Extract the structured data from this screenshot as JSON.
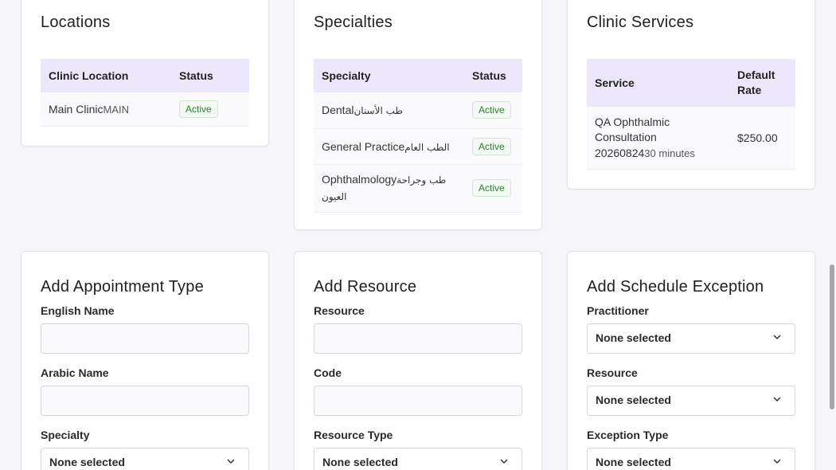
{
  "locations": {
    "title": "Locations",
    "headers": [
      "Clinic Location",
      "Status"
    ],
    "rows": [
      {
        "name": "Main Clinic",
        "code": "MAIN",
        "status": "Active"
      }
    ]
  },
  "specialties": {
    "title": "Specialties",
    "headers": [
      "Specialty",
      "Status"
    ],
    "rows": [
      {
        "name": "Dental",
        "arabic": "طب الأسنان",
        "status": "Active"
      },
      {
        "name": "General Practice",
        "arabic": "الطب العام",
        "status": "Active"
      },
      {
        "name": "Ophthalmology",
        "arabic": "طب وجراحة العيون",
        "status": "Active"
      }
    ]
  },
  "services": {
    "title": "Clinic Services",
    "headers": [
      "Service",
      "Default Rate"
    ],
    "rows": [
      {
        "name_line1": "QA Ophthalmic",
        "name_line2": "Consultation",
        "name_line3": "20260824",
        "duration": "30 minutes",
        "rate": "$250.00"
      }
    ]
  },
  "add_appointment_type": {
    "title": "Add Appointment Type",
    "english_name_label": "English Name",
    "english_name_value": "",
    "arabic_name_label": "Arabic Name",
    "arabic_name_value": "",
    "specialty_label": "Specialty",
    "specialty_value": "None selected"
  },
  "add_resource": {
    "title": "Add Resource",
    "resource_label": "Resource",
    "resource_value": "",
    "code_label": "Code",
    "code_value": "",
    "resource_type_label": "Resource Type",
    "resource_type_value": "None selected"
  },
  "add_schedule_exception": {
    "title": "Add Schedule Exception",
    "practitioner_label": "Practitioner",
    "practitioner_value": "None selected",
    "resource_label": "Resource",
    "resource_value": "None selected",
    "exception_type_label": "Exception Type",
    "exception_type_value": "None selected"
  },
  "colors": {
    "table_header_bg": "#ece7fb",
    "status_active": "#2e7d32",
    "page_bg": "#f6f6fa"
  }
}
